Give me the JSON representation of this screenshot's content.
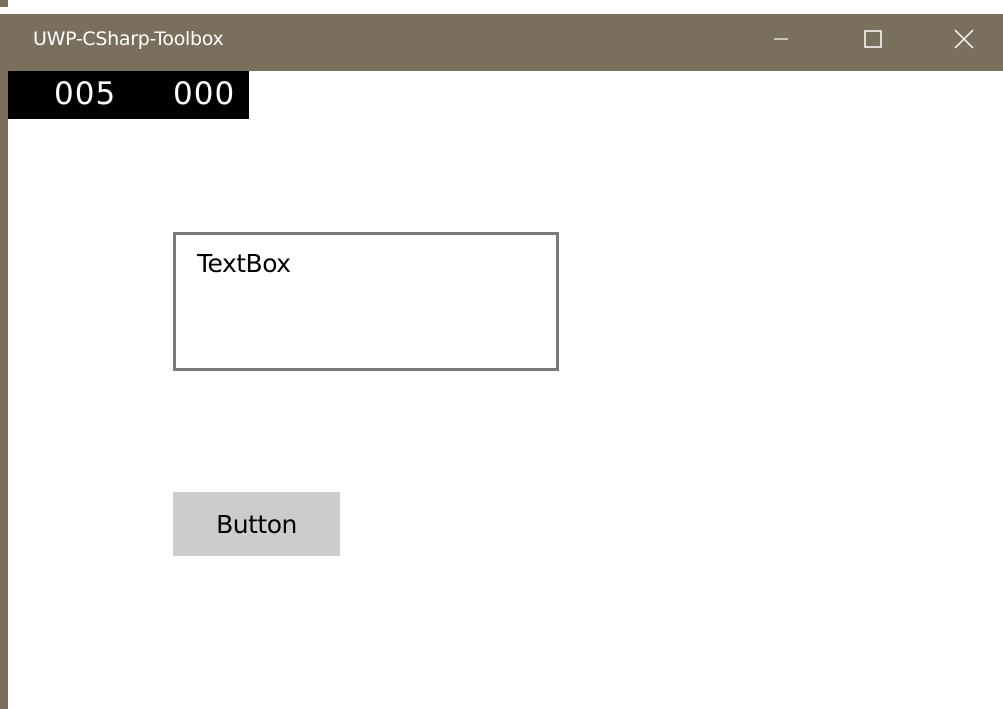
{
  "window": {
    "title": "UWP-CSharp-Toolbox",
    "accent_color": "#7a6e5c",
    "caption_buttons": {
      "minimize_icon": "minimize-icon",
      "maximize_icon": "maximize-icon",
      "close_icon": "close-icon"
    }
  },
  "counter": {
    "value_left": "005",
    "value_right": "000",
    "background": "#000000",
    "foreground": "#ffffff"
  },
  "textbox": {
    "value": "TextBox",
    "border_color": "#7a7a7a"
  },
  "button": {
    "label": "Button",
    "background": "#cccccc"
  }
}
